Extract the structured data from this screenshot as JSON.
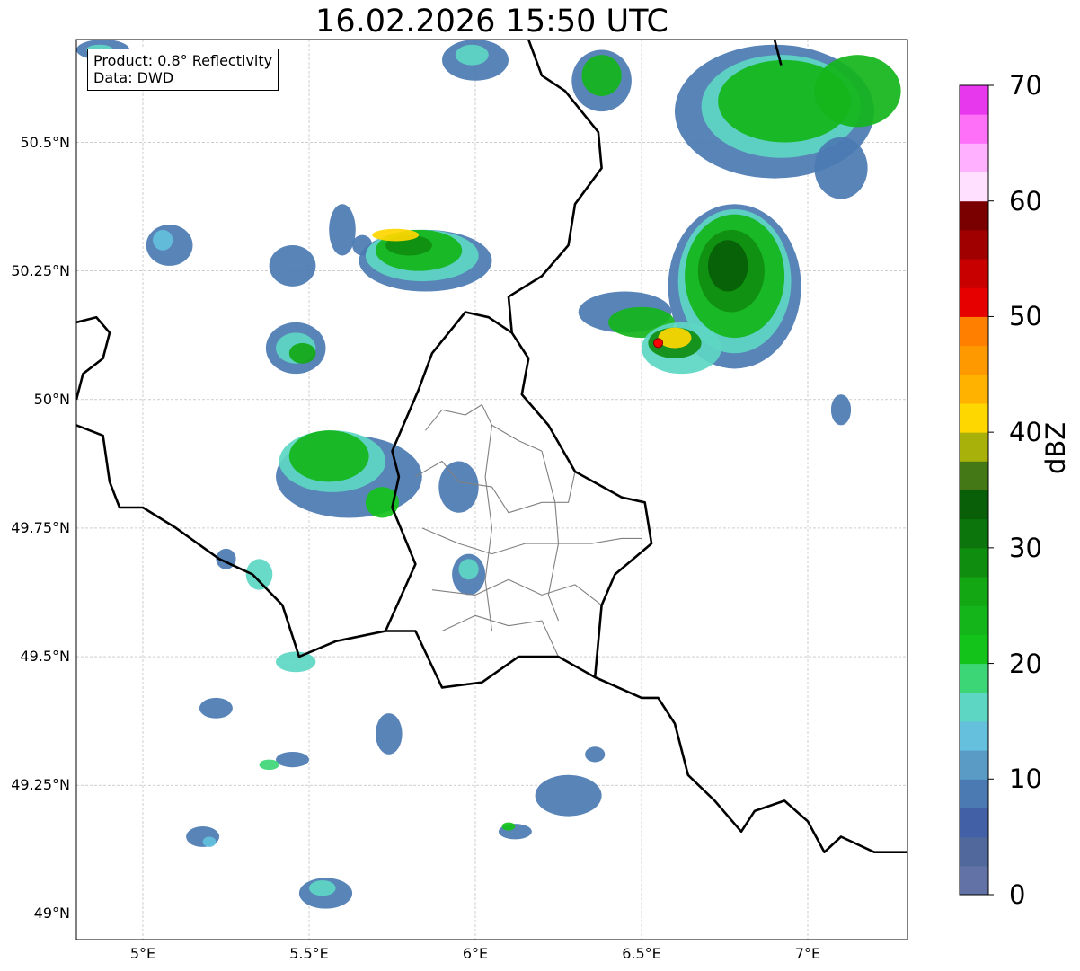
{
  "title": "16.02.2026 15:50 UTC",
  "info": {
    "product": "Product: 0.8° Reflectivity",
    "data_source": "Data: DWD"
  },
  "map": {
    "lon_range": [
      4.8,
      7.3
    ],
    "lat_range": [
      48.95,
      50.7
    ],
    "lat_ticks": [
      {
        "value": 50.5,
        "label": "50.5°N"
      },
      {
        "value": 50.25,
        "label": "50.25°N"
      },
      {
        "value": 50.0,
        "label": "50°N"
      },
      {
        "value": 49.75,
        "label": "49.75°N"
      },
      {
        "value": 49.5,
        "label": "49.5°N"
      },
      {
        "value": 49.25,
        "label": "49.25°N"
      },
      {
        "value": 49.0,
        "label": "49°N"
      }
    ],
    "lon_ticks": [
      {
        "value": 5.0,
        "label": "5°E"
      },
      {
        "value": 5.5,
        "label": "5.5°E"
      },
      {
        "value": 6.0,
        "label": "6°E"
      },
      {
        "value": 6.5,
        "label": "6.5°E"
      },
      {
        "value": 7.0,
        "label": "7°E"
      }
    ],
    "radar_site": {
      "lon": 6.55,
      "lat": 50.11,
      "color": "#ff0000"
    }
  },
  "colorbar": {
    "unit": "dBZ",
    "min": 0,
    "max": 70,
    "step": 2.5,
    "ticks": [
      0,
      10,
      20,
      30,
      40,
      50,
      60,
      70
    ],
    "colors": [
      "#6272a6",
      "#51689c",
      "#4260a6",
      "#4b7ab2",
      "#5a9bc6",
      "#64c0dc",
      "#5dd7c3",
      "#3dd676",
      "#14c31a",
      "#14b51a",
      "#13a714",
      "#0f8d0f",
      "#0c760c",
      "#085f08",
      "#447715",
      "#a8b10a",
      "#ffd700",
      "#ffb300",
      "#ff9900",
      "#ff7f00",
      "#e60000",
      "#c80000",
      "#a00000",
      "#7a0000",
      "#ffe0ff",
      "#ffb0ff",
      "#ff70f9",
      "#e838ee"
    ]
  },
  "echoes": [
    {
      "lon": 4.88,
      "lat": 50.68,
      "rx": 0.08,
      "ry": 0.02,
      "color": "#4b7ab2"
    },
    {
      "lon": 4.87,
      "lat": 50.68,
      "rx": 0.04,
      "ry": 0.01,
      "color": "#5dd7c3"
    },
    {
      "lon": 5.08,
      "lat": 50.3,
      "rx": 0.07,
      "ry": 0.04,
      "color": "#4b7ab2"
    },
    {
      "lon": 5.06,
      "lat": 50.31,
      "rx": 0.03,
      "ry": 0.02,
      "color": "#64c0dc"
    },
    {
      "lon": 5.45,
      "lat": 50.26,
      "rx": 0.07,
      "ry": 0.04,
      "color": "#4b7ab2"
    },
    {
      "lon": 5.6,
      "lat": 50.33,
      "rx": 0.04,
      "ry": 0.05,
      "color": "#4b7ab2"
    },
    {
      "lon": 5.66,
      "lat": 50.3,
      "rx": 0.03,
      "ry": 0.02,
      "color": "#4b7ab2"
    },
    {
      "lon": 5.85,
      "lat": 50.27,
      "rx": 0.2,
      "ry": 0.06,
      "color": "#4b7ab2"
    },
    {
      "lon": 5.84,
      "lat": 50.28,
      "rx": 0.17,
      "ry": 0.05,
      "color": "#5dd7c3"
    },
    {
      "lon": 5.83,
      "lat": 50.29,
      "rx": 0.13,
      "ry": 0.04,
      "color": "#14b51a"
    },
    {
      "lon": 5.8,
      "lat": 50.3,
      "rx": 0.07,
      "ry": 0.02,
      "color": "#0f8d0f"
    },
    {
      "lon": 5.76,
      "lat": 50.32,
      "rx": 0.07,
      "ry": 0.012,
      "color": "#ffd700"
    },
    {
      "lon": 5.46,
      "lat": 50.1,
      "rx": 0.09,
      "ry": 0.05,
      "color": "#4b7ab2"
    },
    {
      "lon": 5.46,
      "lat": 50.1,
      "rx": 0.06,
      "ry": 0.03,
      "color": "#5dd7c3"
    },
    {
      "lon": 5.48,
      "lat": 50.09,
      "rx": 0.04,
      "ry": 0.02,
      "color": "#13a714"
    },
    {
      "lon": 5.62,
      "lat": 49.85,
      "rx": 0.22,
      "ry": 0.08,
      "color": "#4b7ab2"
    },
    {
      "lon": 5.57,
      "lat": 49.88,
      "rx": 0.16,
      "ry": 0.06,
      "color": "#5dd7c3"
    },
    {
      "lon": 5.56,
      "lat": 49.89,
      "rx": 0.12,
      "ry": 0.05,
      "color": "#14b51a"
    },
    {
      "lon": 5.72,
      "lat": 49.8,
      "rx": 0.05,
      "ry": 0.03,
      "color": "#14c31a"
    },
    {
      "lon": 5.95,
      "lat": 49.83,
      "rx": 0.06,
      "ry": 0.05,
      "color": "#4b7ab2"
    },
    {
      "lon": 6.0,
      "lat": 50.66,
      "rx": 0.1,
      "ry": 0.04,
      "color": "#4b7ab2"
    },
    {
      "lon": 5.99,
      "lat": 50.67,
      "rx": 0.05,
      "ry": 0.02,
      "color": "#5dd7c3"
    },
    {
      "lon": 6.38,
      "lat": 50.62,
      "rx": 0.09,
      "ry": 0.06,
      "color": "#4b7ab2"
    },
    {
      "lon": 6.38,
      "lat": 50.63,
      "rx": 0.06,
      "ry": 0.04,
      "color": "#14b51a"
    },
    {
      "lon": 6.9,
      "lat": 50.56,
      "rx": 0.3,
      "ry": 0.13,
      "color": "#4b7ab2"
    },
    {
      "lon": 6.92,
      "lat": 50.57,
      "rx": 0.24,
      "ry": 0.1,
      "color": "#5dd7c3"
    },
    {
      "lon": 6.93,
      "lat": 50.58,
      "rx": 0.2,
      "ry": 0.08,
      "color": "#14b51a"
    },
    {
      "lon": 7.15,
      "lat": 50.6,
      "rx": 0.13,
      "ry": 0.07,
      "color": "#14b51a"
    },
    {
      "lon": 7.1,
      "lat": 50.45,
      "rx": 0.08,
      "ry": 0.06,
      "color": "#4b7ab2"
    },
    {
      "lon": 6.78,
      "lat": 50.22,
      "rx": 0.2,
      "ry": 0.16,
      "color": "#4b7ab2"
    },
    {
      "lon": 6.78,
      "lat": 50.23,
      "rx": 0.17,
      "ry": 0.14,
      "color": "#5dd7c3"
    },
    {
      "lon": 6.78,
      "lat": 50.24,
      "rx": 0.15,
      "ry": 0.12,
      "color": "#14b51a"
    },
    {
      "lon": 6.77,
      "lat": 50.25,
      "rx": 0.1,
      "ry": 0.08,
      "color": "#0f8d0f"
    },
    {
      "lon": 6.76,
      "lat": 50.26,
      "rx": 0.06,
      "ry": 0.05,
      "color": "#085f08"
    },
    {
      "lon": 6.45,
      "lat": 50.17,
      "rx": 0.14,
      "ry": 0.04,
      "color": "#4b7ab2"
    },
    {
      "lon": 6.5,
      "lat": 50.15,
      "rx": 0.1,
      "ry": 0.03,
      "color": "#14b51a"
    },
    {
      "lon": 6.62,
      "lat": 50.1,
      "rx": 0.12,
      "ry": 0.05,
      "color": "#5dd7c3"
    },
    {
      "lon": 6.6,
      "lat": 50.11,
      "rx": 0.08,
      "ry": 0.03,
      "color": "#0f8d0f"
    },
    {
      "lon": 6.6,
      "lat": 50.12,
      "rx": 0.05,
      "ry": 0.02,
      "color": "#ffd700"
    },
    {
      "lon": 7.1,
      "lat": 49.98,
      "rx": 0.03,
      "ry": 0.03,
      "color": "#4b7ab2"
    },
    {
      "lon": 5.25,
      "lat": 49.69,
      "rx": 0.03,
      "ry": 0.02,
      "color": "#4b7ab2"
    },
    {
      "lon": 5.35,
      "lat": 49.66,
      "rx": 0.04,
      "ry": 0.03,
      "color": "#5dd7c3"
    },
    {
      "lon": 5.98,
      "lat": 49.66,
      "rx": 0.05,
      "ry": 0.04,
      "color": "#4b7ab2"
    },
    {
      "lon": 5.98,
      "lat": 49.67,
      "rx": 0.03,
      "ry": 0.02,
      "color": "#5dd7c3"
    },
    {
      "lon": 5.46,
      "lat": 49.49,
      "rx": 0.06,
      "ry": 0.02,
      "color": "#5dd7c3"
    },
    {
      "lon": 5.22,
      "lat": 49.4,
      "rx": 0.05,
      "ry": 0.02,
      "color": "#4b7ab2"
    },
    {
      "lon": 5.74,
      "lat": 49.35,
      "rx": 0.04,
      "ry": 0.04,
      "color": "#4b7ab2"
    },
    {
      "lon": 5.45,
      "lat": 49.3,
      "rx": 0.05,
      "ry": 0.015,
      "color": "#4b7ab2"
    },
    {
      "lon": 5.38,
      "lat": 49.29,
      "rx": 0.03,
      "ry": 0.01,
      "color": "#3dd676"
    },
    {
      "lon": 6.28,
      "lat": 49.23,
      "rx": 0.1,
      "ry": 0.04,
      "color": "#4b7ab2"
    },
    {
      "lon": 6.36,
      "lat": 49.31,
      "rx": 0.03,
      "ry": 0.015,
      "color": "#4b7ab2"
    },
    {
      "lon": 6.12,
      "lat": 49.16,
      "rx": 0.05,
      "ry": 0.015,
      "color": "#4b7ab2"
    },
    {
      "lon": 6.1,
      "lat": 49.17,
      "rx": 0.02,
      "ry": 0.008,
      "color": "#14c31a"
    },
    {
      "lon": 5.18,
      "lat": 49.15,
      "rx": 0.05,
      "ry": 0.02,
      "color": "#4b7ab2"
    },
    {
      "lon": 5.2,
      "lat": 49.14,
      "rx": 0.02,
      "ry": 0.01,
      "color": "#64c0dc"
    },
    {
      "lon": 5.55,
      "lat": 49.04,
      "rx": 0.08,
      "ry": 0.03,
      "color": "#4b7ab2"
    },
    {
      "lon": 5.54,
      "lat": 49.05,
      "rx": 0.04,
      "ry": 0.015,
      "color": "#5dd7c3"
    }
  ],
  "borders": [
    [
      [
        4.8,
        50.15
      ],
      [
        4.86,
        50.16
      ],
      [
        4.9,
        50.13
      ],
      [
        4.88,
        50.08
      ],
      [
        4.82,
        50.05
      ],
      [
        4.8,
        50.0
      ]
    ],
    [
      [
        4.8,
        49.95
      ],
      [
        4.88,
        49.93
      ],
      [
        4.9,
        49.84
      ],
      [
        4.93,
        49.79
      ],
      [
        5.0,
        49.79
      ],
      [
        5.1,
        49.75
      ],
      [
        5.23,
        49.69
      ],
      [
        5.33,
        49.66
      ],
      [
        5.42,
        49.6
      ],
      [
        5.47,
        49.5
      ],
      [
        5.58,
        49.53
      ],
      [
        5.73,
        49.55
      ],
      [
        5.82,
        49.55
      ],
      [
        5.9,
        49.44
      ],
      [
        6.02,
        49.45
      ],
      [
        6.13,
        49.5
      ],
      [
        6.25,
        49.5
      ],
      [
        6.36,
        49.46
      ],
      [
        6.5,
        49.42
      ],
      [
        6.55,
        49.42
      ],
      [
        6.6,
        49.37
      ],
      [
        6.64,
        49.27
      ],
      [
        6.72,
        49.22
      ],
      [
        6.8,
        49.16
      ],
      [
        6.84,
        49.2
      ],
      [
        6.93,
        49.22
      ],
      [
        7.0,
        49.18
      ],
      [
        7.05,
        49.12
      ],
      [
        7.1,
        49.15
      ],
      [
        7.2,
        49.12
      ],
      [
        7.3,
        49.12
      ]
    ],
    [
      [
        5.73,
        49.55
      ],
      [
        5.82,
        49.68
      ],
      [
        5.75,
        49.79
      ],
      [
        5.77,
        49.85
      ],
      [
        5.75,
        49.9
      ],
      [
        5.83,
        50.02
      ],
      [
        5.87,
        50.09
      ],
      [
        5.97,
        50.17
      ],
      [
        6.04,
        50.16
      ],
      [
        6.11,
        50.13
      ],
      [
        6.16,
        50.08
      ],
      [
        6.14,
        50.01
      ],
      [
        6.22,
        49.95
      ],
      [
        6.3,
        49.86
      ],
      [
        6.44,
        49.81
      ],
      [
        6.51,
        49.8
      ],
      [
        6.53,
        49.72
      ],
      [
        6.42,
        49.66
      ],
      [
        6.38,
        49.6
      ],
      [
        6.36,
        49.46
      ]
    ],
    [
      [
        6.11,
        50.13
      ],
      [
        6.1,
        50.2
      ],
      [
        6.2,
        50.24
      ],
      [
        6.28,
        50.3
      ],
      [
        6.3,
        50.38
      ],
      [
        6.38,
        50.45
      ],
      [
        6.37,
        50.52
      ],
      [
        6.27,
        50.6
      ],
      [
        6.2,
        50.63
      ],
      [
        6.16,
        50.7
      ]
    ],
    [
      [
        6.9,
        50.7
      ],
      [
        6.92,
        50.65
      ]
    ]
  ],
  "cantons": [
    [
      [
        5.85,
        49.94
      ],
      [
        5.9,
        49.98
      ],
      [
        5.97,
        49.97
      ],
      [
        6.02,
        49.99
      ],
      [
        6.05,
        49.95
      ],
      [
        6.13,
        49.92
      ],
      [
        6.2,
        49.9
      ]
    ],
    [
      [
        5.82,
        49.85
      ],
      [
        5.9,
        49.88
      ],
      [
        5.95,
        49.84
      ],
      [
        6.05,
        49.83
      ],
      [
        6.1,
        49.78
      ],
      [
        6.2,
        49.8
      ],
      [
        6.28,
        49.8
      ],
      [
        6.3,
        49.86
      ]
    ],
    [
      [
        5.84,
        49.75
      ],
      [
        5.95,
        49.72
      ],
      [
        6.05,
        49.7
      ],
      [
        6.15,
        49.72
      ],
      [
        6.25,
        49.72
      ],
      [
        6.35,
        49.72
      ],
      [
        6.44,
        49.73
      ],
      [
        6.5,
        49.73
      ]
    ],
    [
      [
        5.87,
        49.63
      ],
      [
        6.0,
        49.62
      ],
      [
        6.1,
        49.65
      ],
      [
        6.2,
        49.62
      ],
      [
        6.3,
        49.64
      ],
      [
        6.38,
        49.6
      ]
    ],
    [
      [
        5.9,
        49.55
      ],
      [
        6.0,
        49.58
      ],
      [
        6.1,
        49.56
      ],
      [
        6.2,
        49.57
      ],
      [
        6.25,
        49.5
      ]
    ],
    [
      [
        6.05,
        49.95
      ],
      [
        6.03,
        49.85
      ],
      [
        6.05,
        49.75
      ],
      [
        6.03,
        49.65
      ],
      [
        6.05,
        49.55
      ]
    ],
    [
      [
        6.2,
        49.9
      ],
      [
        6.24,
        49.8
      ],
      [
        6.25,
        49.72
      ],
      [
        6.22,
        49.62
      ],
      [
        6.25,
        49.57
      ]
    ]
  ]
}
